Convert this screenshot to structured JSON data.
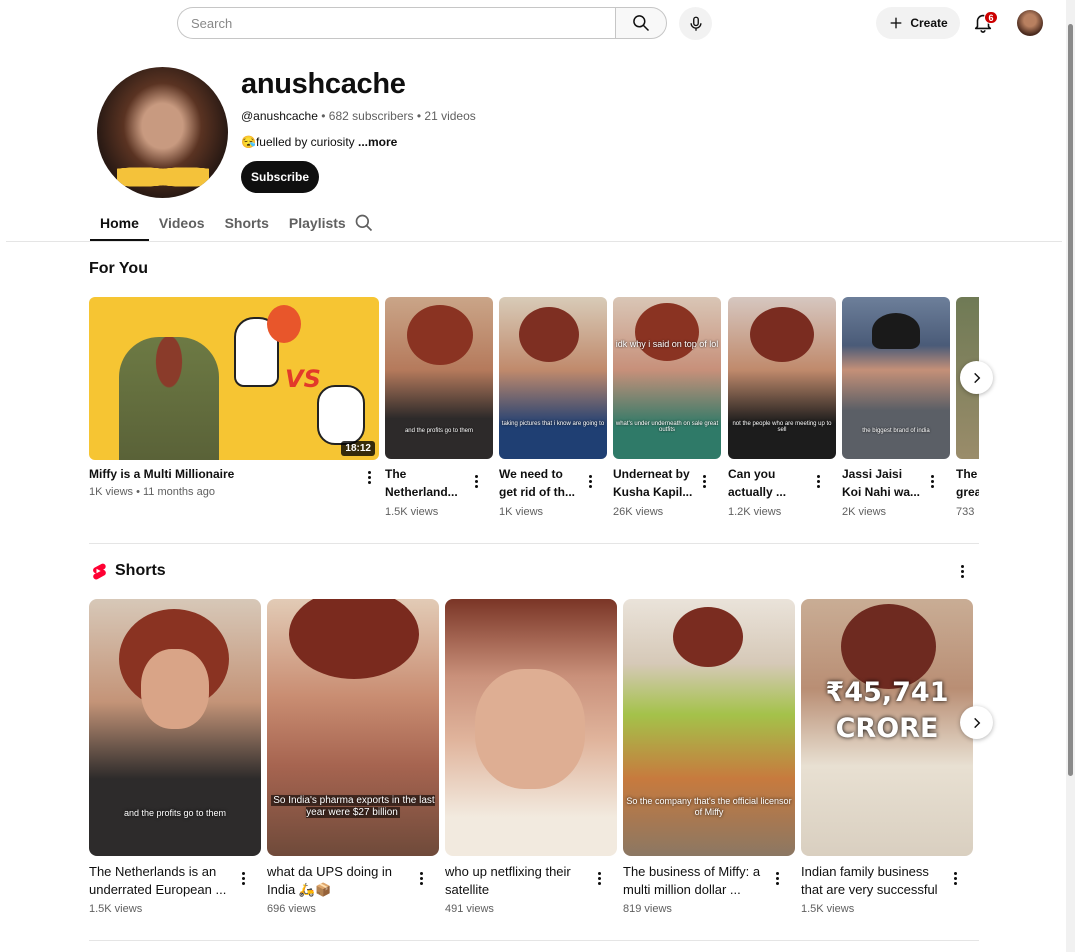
{
  "topbar": {
    "search_placeholder": "Search",
    "create_label": "Create",
    "notification_count": "6"
  },
  "channel": {
    "name": "anushcache",
    "handle": "@anushcache",
    "subscribers": "682 subscribers",
    "videos": "21 videos",
    "description": "fuelled by curiosity ",
    "description_emoji": "😪",
    "more_label": "...more",
    "subscribe_label": "Subscribe"
  },
  "tabs": [
    {
      "label": "Home",
      "active": true
    },
    {
      "label": "Videos",
      "active": false
    },
    {
      "label": "Shorts",
      "active": false
    },
    {
      "label": "Playlists",
      "active": false
    }
  ],
  "for_you": {
    "title": "For You",
    "featured": {
      "title": "Miffy is a Multi Millionaire",
      "views": "1K views",
      "age": "11 months ago",
      "duration": "18:12"
    },
    "videos": [
      {
        "title": "The Netherland...",
        "views": "1.5K views",
        "caption": "and the profits go to them"
      },
      {
        "title": "We need to get rid of th...",
        "views": "1K views",
        "caption": "taking pictures that i know are going to"
      },
      {
        "title": "Underneat by Kusha Kapil...",
        "views": "26K views",
        "caption": "what's under underneath on sale great outfits",
        "overlay": "idk why i said on top of lol"
      },
      {
        "title": "Can you actually ...",
        "views": "1.2K views",
        "caption": "not the people who are meeting up to sell"
      },
      {
        "title": "Jassi Jaisi Koi Nahi wa...",
        "views": "2K views",
        "caption": "the biggest brand of india"
      },
      {
        "title": "The great",
        "views": "733",
        "caption": ""
      }
    ]
  },
  "shorts": {
    "title": "Shorts",
    "items": [
      {
        "title": "The Netherlands is an underrated European ...",
        "views": "1.5K views",
        "caption": "and the profits go to them"
      },
      {
        "title": "what da UPS doing in India 🛵📦",
        "views": "696 views",
        "caption": "So India's pharma exports in the last year were $27 billion"
      },
      {
        "title": "who up netflixing their satellite",
        "views": "491 views",
        "caption": ""
      },
      {
        "title": "The business of Miffy: a multi million dollar ...",
        "views": "819 views",
        "caption": "So the company that's the official licensor of Miffy"
      },
      {
        "title": "Indian family business that are very successful",
        "views": "1.5K views",
        "caption": "",
        "overlay_top": "₹45,741",
        "overlay_bottom": "CRORE"
      }
    ]
  }
}
